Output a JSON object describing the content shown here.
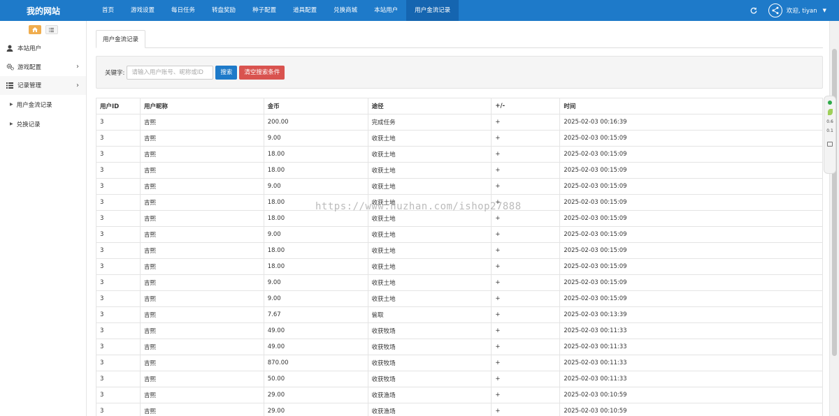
{
  "brand": "我的网站",
  "nav": [
    {
      "label": "首页"
    },
    {
      "label": "游戏设置"
    },
    {
      "label": "每日任务"
    },
    {
      "label": "转盘奖励"
    },
    {
      "label": "种子配置"
    },
    {
      "label": "道具配置"
    },
    {
      "label": "兑换商城"
    },
    {
      "label": "本站用户"
    },
    {
      "label": "用户金流记录"
    }
  ],
  "active_nav": "用户金流记录",
  "user": {
    "welcome": "欢迎, tiyan"
  },
  "sidebar": {
    "items": [
      {
        "label": "本站用户",
        "icon": "user-icon"
      },
      {
        "label": "游戏配置",
        "icon": "gears-icon"
      },
      {
        "label": "记录管理",
        "icon": "list-icon"
      }
    ],
    "sub_items": [
      {
        "label": "用户金流记录"
      },
      {
        "label": "兑换记录"
      }
    ]
  },
  "tab": {
    "label": "用户金流记录"
  },
  "search": {
    "label": "关键字:",
    "placeholder": "请输入用户账号、昵称或ID",
    "search_button": "搜索",
    "clear_button": "清空搜索条件"
  },
  "table": {
    "headers": [
      "用户ID",
      "用户昵称",
      "金币",
      "途径",
      "+/-",
      "时间"
    ],
    "rows": [
      [
        "3",
        "吉熙",
        "200.00",
        "完成任务",
        "+",
        "2025-02-03 00:16:39"
      ],
      [
        "3",
        "吉熙",
        "9.00",
        "收获土地",
        "+",
        "2025-02-03 00:15:09"
      ],
      [
        "3",
        "吉熙",
        "18.00",
        "收获土地",
        "+",
        "2025-02-03 00:15:09"
      ],
      [
        "3",
        "吉熙",
        "18.00",
        "收获土地",
        "+",
        "2025-02-03 00:15:09"
      ],
      [
        "3",
        "吉熙",
        "9.00",
        "收获土地",
        "+",
        "2025-02-03 00:15:09"
      ],
      [
        "3",
        "吉熙",
        "18.00",
        "收获土地",
        "+",
        "2025-02-03 00:15:09"
      ],
      [
        "3",
        "吉熙",
        "18.00",
        "收获土地",
        "+",
        "2025-02-03 00:15:09"
      ],
      [
        "3",
        "吉熙",
        "9.00",
        "收获土地",
        "+",
        "2025-02-03 00:15:09"
      ],
      [
        "3",
        "吉熙",
        "18.00",
        "收获土地",
        "+",
        "2025-02-03 00:15:09"
      ],
      [
        "3",
        "吉熙",
        "18.00",
        "收获土地",
        "+",
        "2025-02-03 00:15:09"
      ],
      [
        "3",
        "吉熙",
        "9.00",
        "收获土地",
        "+",
        "2025-02-03 00:15:09"
      ],
      [
        "3",
        "吉熙",
        "9.00",
        "收获土地",
        "+",
        "2025-02-03 00:15:09"
      ],
      [
        "3",
        "吉熙",
        "7.67",
        "偷取",
        "+",
        "2025-02-03 00:13:39"
      ],
      [
        "3",
        "吉熙",
        "49.00",
        "收获牧场",
        "+",
        "2025-02-03 00:11:33"
      ],
      [
        "3",
        "吉熙",
        "49.00",
        "收获牧场",
        "+",
        "2025-02-03 00:11:33"
      ],
      [
        "3",
        "吉熙",
        "870.00",
        "收获牧场",
        "+",
        "2025-02-03 00:11:33"
      ],
      [
        "3",
        "吉熙",
        "50.00",
        "收获牧场",
        "+",
        "2025-02-03 00:11:33"
      ],
      [
        "3",
        "吉熙",
        "29.00",
        "收获渔场",
        "+",
        "2025-02-03 00:10:59"
      ],
      [
        "3",
        "吉熙",
        "29.00",
        "收获渔场",
        "+",
        "2025-02-03 00:10:59"
      ]
    ]
  },
  "watermark": "https://www.huzhan.com/ishop27888",
  "widget": {
    "values": [
      "0.6",
      "0.1"
    ]
  },
  "colors": {
    "primary": "#1e7ac9",
    "danger": "#d9534f",
    "warning": "#f0ad4e"
  }
}
